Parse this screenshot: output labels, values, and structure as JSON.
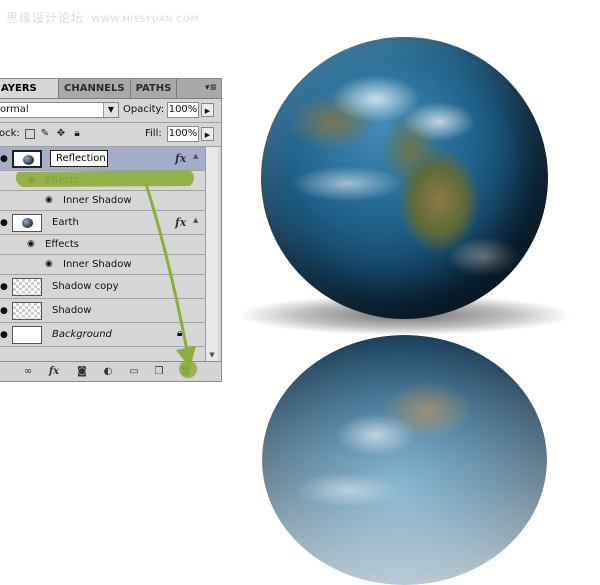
{
  "watermark": {
    "site_name": "思缘设计论坛",
    "url": "WWW.MISSYUAN.COM"
  },
  "panel": {
    "tabs": [
      "AYERS",
      "CHANNELS",
      "PATHS"
    ],
    "menu_glyph": "▾≡",
    "blend_mode": "ormal",
    "opacity_label": "Opacity:",
    "opacity_value": "100%",
    "lock_label": "ock:",
    "fill_label": "Fill:",
    "fill_value": "100%"
  },
  "layers": [
    {
      "name": "Reflection",
      "type": "globe",
      "has_fx": true,
      "selected": true
    },
    {
      "name": "Effects",
      "type": "effects-header"
    },
    {
      "name": "Inner Shadow",
      "type": "effect"
    },
    {
      "name": "Earth",
      "type": "globe",
      "has_fx": true
    },
    {
      "name": "Effects",
      "type": "effects-header"
    },
    {
      "name": "Inner Shadow",
      "type": "effect"
    },
    {
      "name": "Shadow copy",
      "type": "transparent"
    },
    {
      "name": "Shadow",
      "type": "transparent"
    },
    {
      "name": "Background",
      "type": "background",
      "locked": true
    }
  ],
  "tooltip": "Reflection",
  "fx_symbol": "fx",
  "bottom_icons": [
    "link-icon",
    "fx-icon",
    "mask-icon",
    "adjustment-icon",
    "folder-icon",
    "new-layer-icon",
    "trash-icon"
  ],
  "colors": {
    "selection": "#a4adc9",
    "annotation": "#8bae3c",
    "panel_bg": "#d6d6d6"
  }
}
